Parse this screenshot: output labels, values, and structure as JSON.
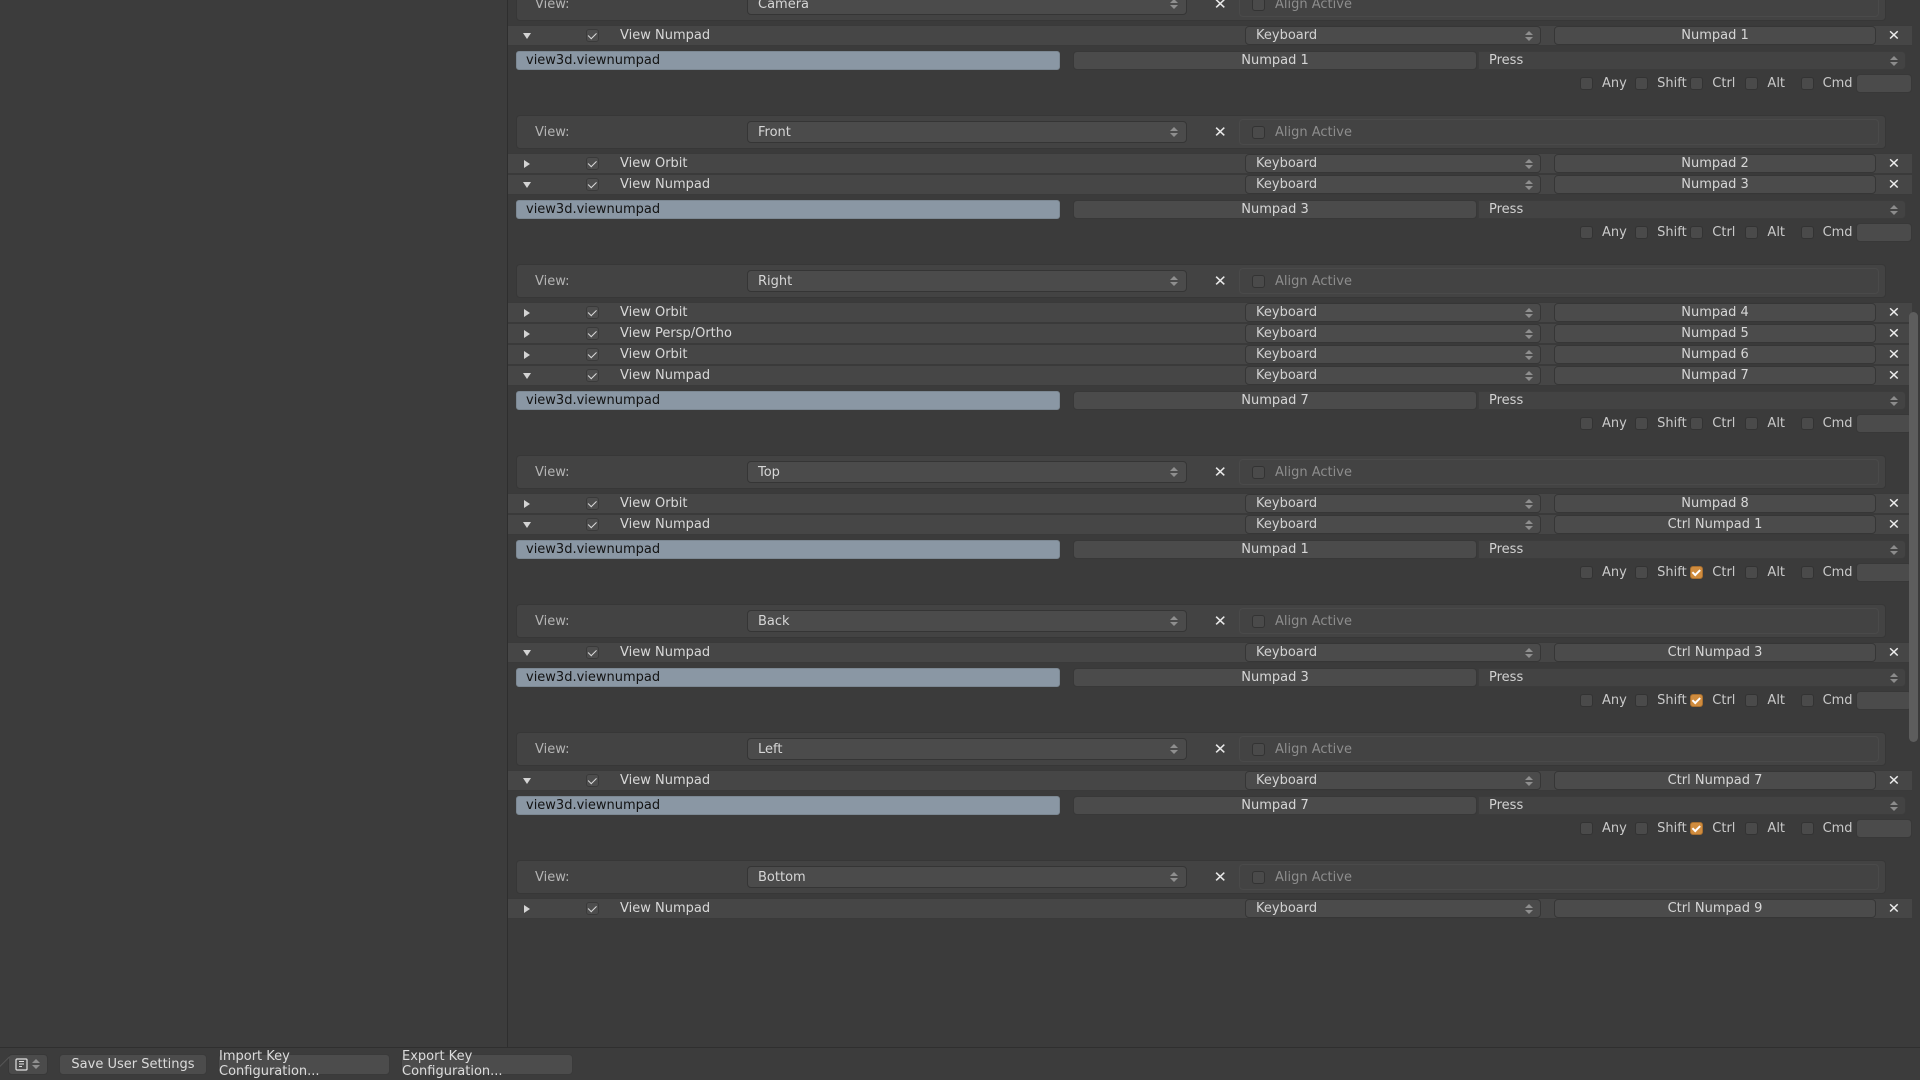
{
  "app": {
    "theme_bg": "#3b3b3b",
    "accent": "#d08c3e",
    "operator_field_bg": "#8a97a4"
  },
  "labels": {
    "view_prop": "View:",
    "align_active": "Align Active",
    "press": "Press",
    "keyboard": "Keyboard",
    "operator_id": "view3d.viewnumpad",
    "mod_any": "Any",
    "mod_shift": "Shift",
    "mod_ctrl": "Ctrl",
    "mod_alt": "Alt",
    "mod_cmd": "Cmd",
    "close_icon": "✕",
    "triangle_open": "triangle-down-icon",
    "triangle_closed": "triangle-right-icon"
  },
  "bottom_bar": {
    "preferences_icon": "preferences-icon",
    "save_user_settings": "Save User Settings",
    "import_key_config": "Import Key Configuration...",
    "export_key_config": "Export Key Configuration..."
  },
  "entries": [
    {
      "kind": "prop",
      "label": "View:",
      "value": "Camera",
      "align_active": "Align Active",
      "align_checked": false
    },
    {
      "kind": "item_expanded",
      "name": "View Numpad",
      "enabled": true,
      "map_type": "Keyboard",
      "key": "Numpad 1",
      "operator": "view3d.viewnumpad",
      "detail_key": "Numpad 1",
      "value_type": "Press",
      "mods": {
        "any": false,
        "shift": false,
        "ctrl": false,
        "alt": false,
        "cmd": false
      }
    },
    {
      "kind": "prop",
      "label": "View:",
      "value": "Front",
      "align_active": "Align Active",
      "align_checked": false
    },
    {
      "kind": "item_collapsed",
      "name": "View Orbit",
      "enabled": true,
      "map_type": "Keyboard",
      "key": "Numpad 2"
    },
    {
      "kind": "item_expanded",
      "name": "View Numpad",
      "enabled": true,
      "map_type": "Keyboard",
      "key": "Numpad 3",
      "operator": "view3d.viewnumpad",
      "detail_key": "Numpad 3",
      "value_type": "Press",
      "mods": {
        "any": false,
        "shift": false,
        "ctrl": false,
        "alt": false,
        "cmd": false
      }
    },
    {
      "kind": "prop",
      "label": "View:",
      "value": "Right",
      "align_active": "Align Active",
      "align_checked": false
    },
    {
      "kind": "item_collapsed",
      "name": "View Orbit",
      "enabled": true,
      "map_type": "Keyboard",
      "key": "Numpad 4"
    },
    {
      "kind": "item_collapsed",
      "name": "View Persp/Ortho",
      "enabled": true,
      "map_type": "Keyboard",
      "key": "Numpad 5"
    },
    {
      "kind": "item_collapsed",
      "name": "View Orbit",
      "enabled": true,
      "map_type": "Keyboard",
      "key": "Numpad 6"
    },
    {
      "kind": "item_expanded",
      "name": "View Numpad",
      "enabled": true,
      "map_type": "Keyboard",
      "key": "Numpad 7",
      "operator": "view3d.viewnumpad",
      "detail_key": "Numpad 7",
      "value_type": "Press",
      "mods": {
        "any": false,
        "shift": false,
        "ctrl": false,
        "alt": false,
        "cmd": false
      }
    },
    {
      "kind": "prop",
      "label": "View:",
      "value": "Top",
      "align_active": "Align Active",
      "align_checked": false
    },
    {
      "kind": "item_collapsed",
      "name": "View Orbit",
      "enabled": true,
      "map_type": "Keyboard",
      "key": "Numpad 8"
    },
    {
      "kind": "item_expanded",
      "name": "View Numpad",
      "enabled": true,
      "map_type": "Keyboard",
      "key": "Ctrl Numpad 1",
      "operator": "view3d.viewnumpad",
      "detail_key": "Numpad 1",
      "value_type": "Press",
      "mods": {
        "any": false,
        "shift": false,
        "ctrl": true,
        "alt": false,
        "cmd": false
      }
    },
    {
      "kind": "prop",
      "label": "View:",
      "value": "Back",
      "align_active": "Align Active",
      "align_checked": false
    },
    {
      "kind": "item_expanded",
      "name": "View Numpad",
      "enabled": true,
      "map_type": "Keyboard",
      "key": "Ctrl Numpad 3",
      "operator": "view3d.viewnumpad",
      "detail_key": "Numpad 3",
      "value_type": "Press",
      "mods": {
        "any": false,
        "shift": false,
        "ctrl": true,
        "alt": false,
        "cmd": false
      }
    },
    {
      "kind": "prop",
      "label": "View:",
      "value": "Left",
      "align_active": "Align Active",
      "align_checked": false
    },
    {
      "kind": "item_expanded",
      "name": "View Numpad",
      "enabled": true,
      "map_type": "Keyboard",
      "key": "Ctrl Numpad 7",
      "operator": "view3d.viewnumpad",
      "detail_key": "Numpad 7",
      "value_type": "Press",
      "mods": {
        "any": false,
        "shift": false,
        "ctrl": true,
        "alt": false,
        "cmd": false
      }
    },
    {
      "kind": "prop",
      "label": "View:",
      "value": "Bottom",
      "align_active": "Align Active",
      "align_checked": false
    },
    {
      "kind": "item_collapsed_partial",
      "name": "View Numpad",
      "enabled": true,
      "map_type": "Keyboard",
      "key": "Ctrl Numpad 9"
    }
  ]
}
